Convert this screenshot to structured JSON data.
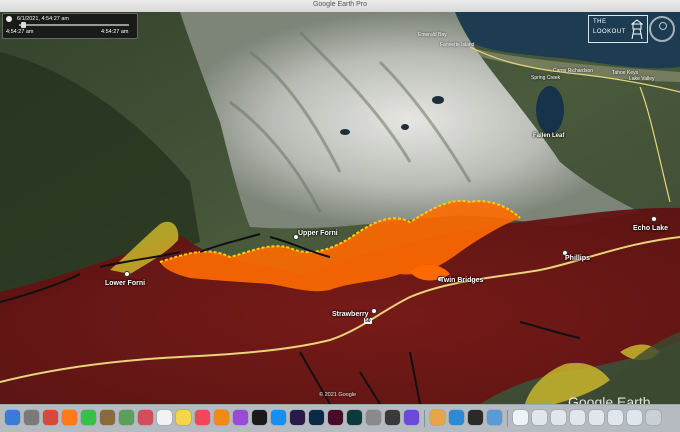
{
  "window": {
    "title": "Google Earth Pro"
  },
  "time_slider": {
    "date": "6/1/2021,  4:54:27 am",
    "start": "4:54:27 am",
    "end": "4:54:27 am"
  },
  "logo": {
    "line1": "THE",
    "line2": "LOOKOUT"
  },
  "labels": {
    "emerald_bay": "Emerald Bay",
    "fannette_island": "Fannette Island",
    "camp_richardson": "Camp Richardson",
    "spring_creek": "Spring Creek",
    "tahoe_keys": "Tahoe Keys",
    "lake_valley": "Lake Valley",
    "fallen_leaf": "Fallen Leaf",
    "upper_forni": "Upper Forni",
    "lower_forni": "Lower Forni",
    "echo_lake": "Echo Lake",
    "phillips": "Phillips",
    "twin_bridges": "Twin Bridges",
    "strawberry": "Strawberry",
    "route_shield": "50"
  },
  "copyright": "© 2021 Google",
  "brand": "Google Earth",
  "colors": {
    "burn_perimeter": "#6e1414",
    "active_fire": "#ff6a00",
    "fire_edge": "#ffd000",
    "yellow_zone": "#c9b52c",
    "highway": "#e8d27a"
  },
  "dock": {
    "icons": [
      "finder-icon",
      "launchpad-icon",
      "siri-icon",
      "firefox-icon",
      "messages-icon",
      "facetime-icon",
      "photo-booth-icon",
      "app-icon",
      "reminders-icon",
      "notes-icon",
      "music-icon",
      "vlc-icon",
      "podcasts-icon",
      "tv-icon",
      "app-store-icon",
      "premiere-icon",
      "photoshop-icon",
      "indesign-icon",
      "audition-icon",
      "system-prefs-icon",
      "davinci-icon",
      "firefox-dev-icon",
      "photos-icon",
      "safari-icon",
      "quicktime-icon",
      "preview-icon",
      "document-icon",
      "folder-icon",
      "folder-icon",
      "folder-icon",
      "folder-icon",
      "trash-icon"
    ]
  }
}
